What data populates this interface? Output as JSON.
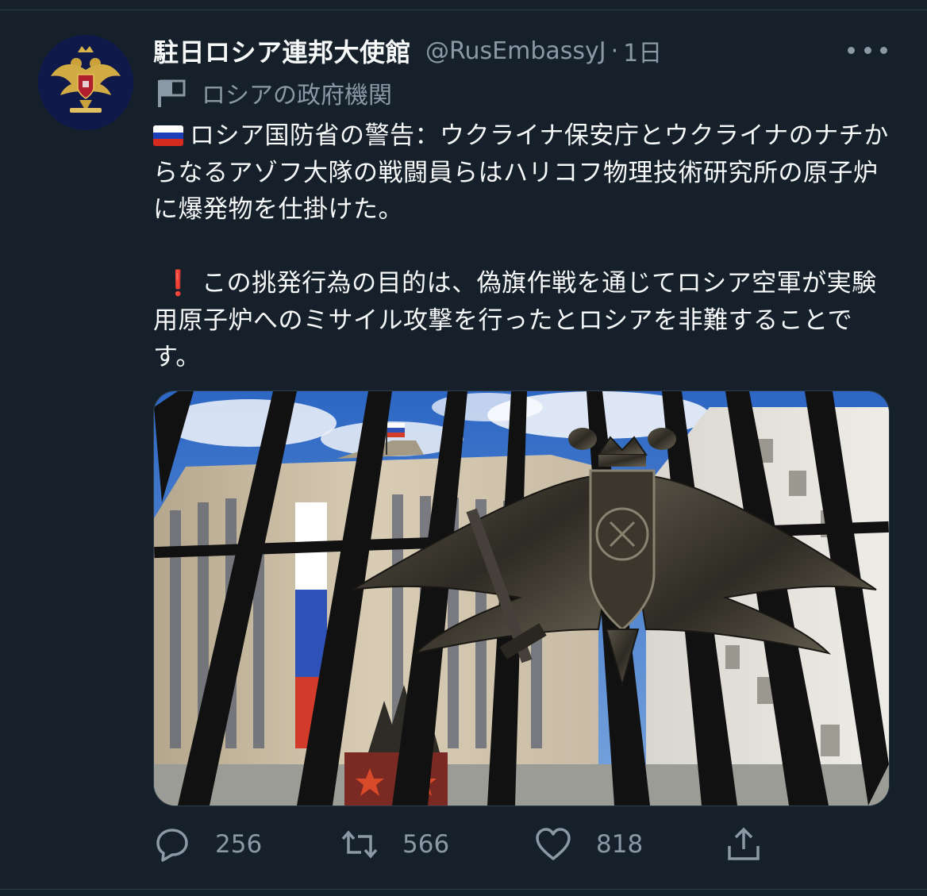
{
  "tweet": {
    "display_name": "駐日ロシア連邦大使館",
    "handle": "@RusEmbassyJ",
    "separator": "·",
    "time": "1日",
    "gov_label": "ロシアの政府機関",
    "paragraph1": "ロシア国防省の警告：ウクライナ保安庁とウクライナのナチからなるアゾフ大隊の戦闘員らはハリコフ物理技術研究所の原子炉に爆発物を仕掛けた。",
    "paragraph2_mark": "❗",
    "paragraph2": "この挑発行為の目的は、偽旗作戦を通じてロシア空軍が実験用原子炉へのミサイル攻撃を行ったとロシアを非難することです。"
  },
  "icons": {
    "avatar": "double-headed-eagle-emblem",
    "more": "ellipsis-icon",
    "gov_label": "flag-icon",
    "flag_emoji": "russian-flag-icon",
    "reply": "reply-icon",
    "retweet": "retweet-icon",
    "like": "heart-icon",
    "share": "share-icon"
  },
  "actions": {
    "reply_count": "256",
    "retweet_count": "566",
    "like_count": "818"
  },
  "colors": {
    "background": "#15202b",
    "text": "#f7f9f9",
    "secondary": "#8b98a5"
  }
}
